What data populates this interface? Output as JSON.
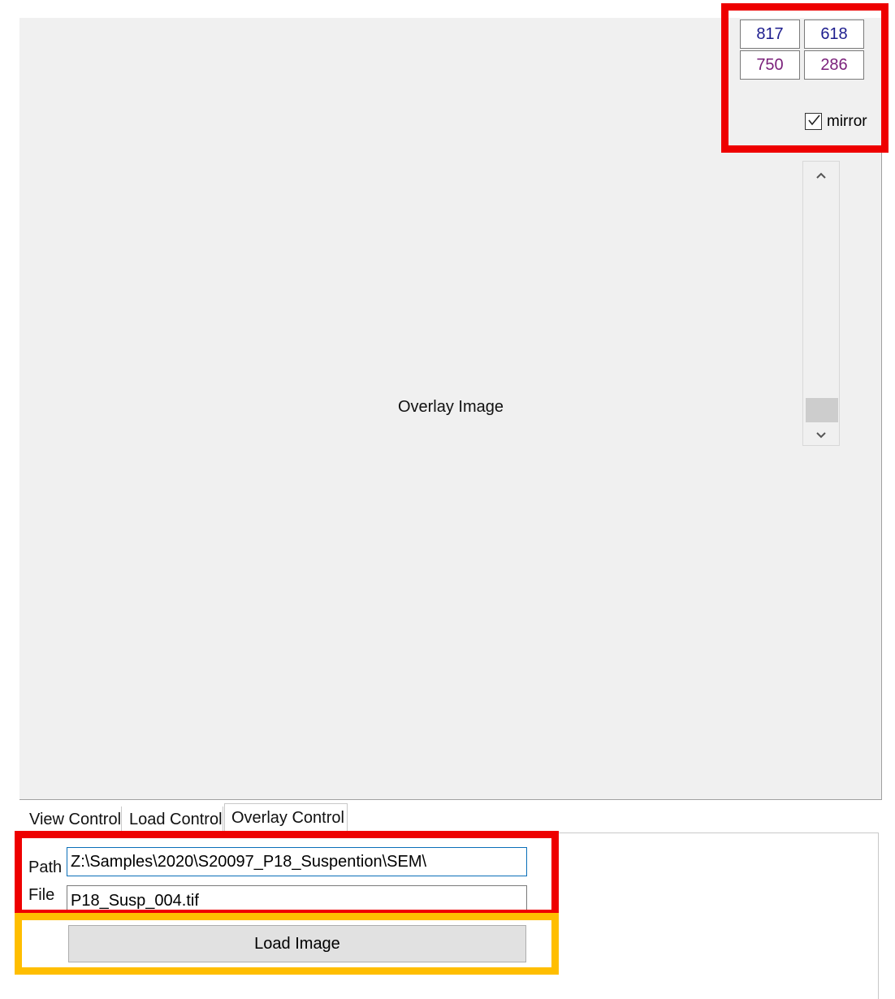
{
  "overlay": {
    "center_label": "Overlay Image"
  },
  "coords": {
    "top_left": "817",
    "top_right": "618",
    "bottom_left": "750",
    "bottom_right": "286",
    "colors": {
      "top_row": "#1d1d8e",
      "bottom_row": "#7a1f7a"
    }
  },
  "mirror": {
    "label": "mirror",
    "checked": true
  },
  "scrollbar": {
    "up_icon": "chevron-up-icon",
    "down_icon": "chevron-down-icon"
  },
  "tabs": [
    {
      "label": "View Control",
      "active": false
    },
    {
      "label": "Load Control",
      "active": false
    },
    {
      "label": "Overlay Control",
      "active": true
    }
  ],
  "form": {
    "path_label": "Path",
    "path_value": "Z:\\Samples\\2020\\S20097_P18_Suspention\\SEM\\",
    "file_label": "File",
    "file_value": "P18_Susp_004.tif",
    "load_button": "Load Image"
  },
  "highlight_colors": {
    "red": "#ee0000",
    "yellow": "#ffbe00"
  }
}
